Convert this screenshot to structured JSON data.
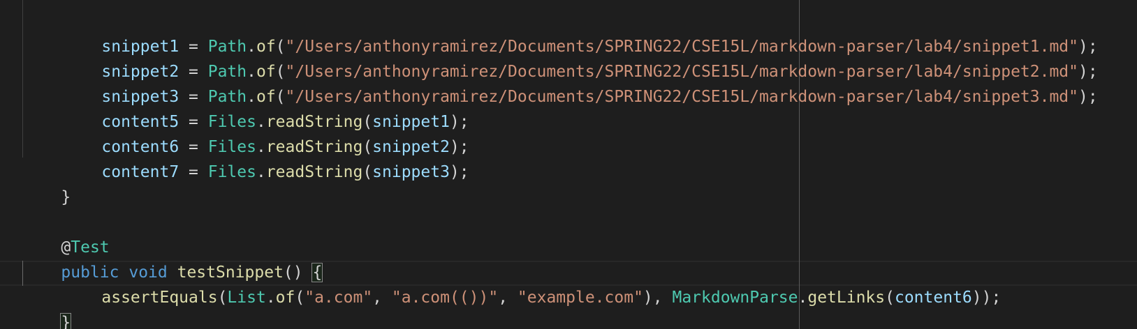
{
  "lines": [
    {
      "tokens": [
        {
          "text": "snippet1",
          "kind": "var"
        },
        {
          "text": " = ",
          "kind": "punc"
        },
        {
          "text": "Path",
          "kind": "type"
        },
        {
          "text": ".",
          "kind": "punc"
        },
        {
          "text": "of",
          "kind": "fn"
        },
        {
          "text": "(",
          "kind": "punc"
        },
        {
          "text": "\"/Users/anthonyramirez/Documents/SPRING22/CSE15L/markdown-parser/lab4/snippet1.md\"",
          "kind": "str"
        },
        {
          "text": ");",
          "kind": "punc"
        }
      ]
    },
    {
      "tokens": [
        {
          "text": "snippet2",
          "kind": "var"
        },
        {
          "text": " = ",
          "kind": "punc"
        },
        {
          "text": "Path",
          "kind": "type"
        },
        {
          "text": ".",
          "kind": "punc"
        },
        {
          "text": "of",
          "kind": "fn"
        },
        {
          "text": "(",
          "kind": "punc"
        },
        {
          "text": "\"/Users/anthonyramirez/Documents/SPRING22/CSE15L/markdown-parser/lab4/snippet2.md\"",
          "kind": "str"
        },
        {
          "text": ");",
          "kind": "punc"
        }
      ]
    },
    {
      "tokens": [
        {
          "text": "snippet3",
          "kind": "var"
        },
        {
          "text": " = ",
          "kind": "punc"
        },
        {
          "text": "Path",
          "kind": "type"
        },
        {
          "text": ".",
          "kind": "punc"
        },
        {
          "text": "of",
          "kind": "fn"
        },
        {
          "text": "(",
          "kind": "punc"
        },
        {
          "text": "\"/Users/anthonyramirez/Documents/SPRING22/CSE15L/markdown-parser/lab4/snippet3.md\"",
          "kind": "str"
        },
        {
          "text": ");",
          "kind": "punc"
        }
      ]
    },
    {
      "tokens": [
        {
          "text": "content5",
          "kind": "var"
        },
        {
          "text": " = ",
          "kind": "punc"
        },
        {
          "text": "Files",
          "kind": "type"
        },
        {
          "text": ".",
          "kind": "punc"
        },
        {
          "text": "readString",
          "kind": "fn"
        },
        {
          "text": "(",
          "kind": "punc"
        },
        {
          "text": "snippet1",
          "kind": "var"
        },
        {
          "text": ");",
          "kind": "punc"
        }
      ]
    },
    {
      "tokens": [
        {
          "text": "content6",
          "kind": "var"
        },
        {
          "text": " = ",
          "kind": "punc"
        },
        {
          "text": "Files",
          "kind": "type"
        },
        {
          "text": ".",
          "kind": "punc"
        },
        {
          "text": "readString",
          "kind": "fn"
        },
        {
          "text": "(",
          "kind": "punc"
        },
        {
          "text": "snippet2",
          "kind": "var"
        },
        {
          "text": ");",
          "kind": "punc"
        }
      ]
    },
    {
      "tokens": [
        {
          "text": "content7",
          "kind": "var"
        },
        {
          "text": " = ",
          "kind": "punc"
        },
        {
          "text": "Files",
          "kind": "type"
        },
        {
          "text": ".",
          "kind": "punc"
        },
        {
          "text": "readString",
          "kind": "fn"
        },
        {
          "text": "(",
          "kind": "punc"
        },
        {
          "text": "snippet3",
          "kind": "var"
        },
        {
          "text": ");",
          "kind": "punc"
        }
      ]
    },
    {
      "tokens": [
        {
          "text": "}",
          "kind": "punc"
        }
      ]
    },
    {
      "tokens": []
    },
    {
      "tokens": [
        {
          "text": "@",
          "kind": "punc"
        },
        {
          "text": "Test",
          "kind": "type"
        }
      ]
    },
    {
      "tokens": [
        {
          "text": "public",
          "kind": "kw"
        },
        {
          "text": " ",
          "kind": "punc"
        },
        {
          "text": "void",
          "kind": "kw"
        },
        {
          "text": " ",
          "kind": "punc"
        },
        {
          "text": "testSnippet",
          "kind": "fn"
        },
        {
          "text": "() ",
          "kind": "punc"
        },
        {
          "text": "{",
          "kind": "punc"
        }
      ]
    },
    {
      "tokens": [
        {
          "text": "assertEquals",
          "kind": "fn"
        },
        {
          "text": "(",
          "kind": "punc"
        },
        {
          "text": "List",
          "kind": "type"
        },
        {
          "text": ".",
          "kind": "punc"
        },
        {
          "text": "of",
          "kind": "fn"
        },
        {
          "text": "(",
          "kind": "punc"
        },
        {
          "text": "\"a.com\"",
          "kind": "str"
        },
        {
          "text": ", ",
          "kind": "punc"
        },
        {
          "text": "\"a.com(())\"",
          "kind": "str"
        },
        {
          "text": ", ",
          "kind": "punc"
        },
        {
          "text": "\"example.com\"",
          "kind": "str"
        },
        {
          "text": "), ",
          "kind": "punc"
        },
        {
          "text": "MarkdownParse",
          "kind": "type"
        },
        {
          "text": ".",
          "kind": "punc"
        },
        {
          "text": "getLinks",
          "kind": "fn"
        },
        {
          "text": "(",
          "kind": "punc"
        },
        {
          "text": "content6",
          "kind": "var"
        },
        {
          "text": "));",
          "kind": "punc"
        }
      ]
    },
    {
      "tokens": [
        {
          "text": "}",
          "kind": "punc"
        }
      ]
    }
  ],
  "colors": {
    "background": "#1e1e1e",
    "variable": "#9cdcfe",
    "type": "#4ec9b0",
    "function": "#dcdcaa",
    "string": "#ce9178",
    "keyword": "#569cd6",
    "punctuation": "#d4d4d4"
  }
}
